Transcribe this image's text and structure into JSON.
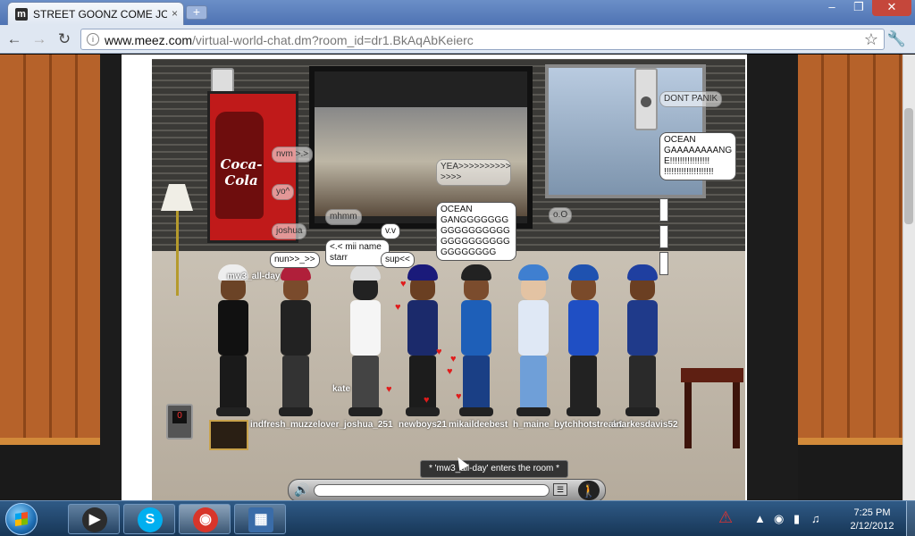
{
  "browser": {
    "tab_title": "STREET GOONZ COME JOI",
    "tab_favicon": "m",
    "tab_close": "×",
    "new_tab": "+",
    "url_host": "www.meez.com",
    "url_path": "/virtual-world-chat.dm?room_id=dr1.BkAqAbKeierc",
    "nav": {
      "back": "←",
      "forward": "→",
      "reload": "↻"
    },
    "window": {
      "minimize": "–",
      "maximize": "❐",
      "close": "✕"
    }
  },
  "game": {
    "vending_label": "Coca-Cola",
    "counter_digit": "0",
    "bubbles": {
      "b_nvm": "nvm >.>",
      "b_yo": "yo^",
      "b_joshua": "joshua",
      "b_nun": "nun>>_>>",
      "b_mhmm": "mhmm",
      "b_mii": "<.< mii name starr",
      "b_vv": "v.v",
      "b_sup": "sup<<",
      "b_yea": "YEA>>>>>>>>>> >>>>",
      "b_ocean_gang": "OCEAN GANGGGGGGG GGGGGGGGGG GGGGGGGGGG GGGGGGGG",
      "b_oo": "o.O",
      "b_dont_panik": "DONT PANIK",
      "b_ocean_2": "OCEAN GAAAAAAAANG E!!!!!!!!!!!!!!!! !!!!!!!!!!!!!!!!!!!!"
    },
    "names": {
      "n_mw3": "mw3_all-day",
      "n_kate": "kate",
      "n_row": "indfresh_muzzelover_joshua_251",
      "n_newboys": "newboys21",
      "n_mikail": "mikaildeebest",
      "n_maine": "h_maine_bytchhotstreak1",
      "n_kesha": "anarkesdavis52"
    },
    "notice": "* 'mw3_all-day' enters the room *",
    "chatbar": {
      "volume_icon": "🔊",
      "list_icon": "☰",
      "walk_icon": "🚶"
    }
  },
  "taskbar": {
    "apps": [
      {
        "name": "media",
        "glyph": "▶",
        "color": "#2c2c2c"
      },
      {
        "name": "skype",
        "glyph": "S",
        "color": "#00aff0"
      },
      {
        "name": "chrome",
        "glyph": "◉",
        "color": "#d8352a"
      },
      {
        "name": "video",
        "glyph": "▦",
        "color": "#3a6ca8"
      }
    ],
    "clock_time": "7:25 PM",
    "clock_date": "2/12/2012"
  }
}
